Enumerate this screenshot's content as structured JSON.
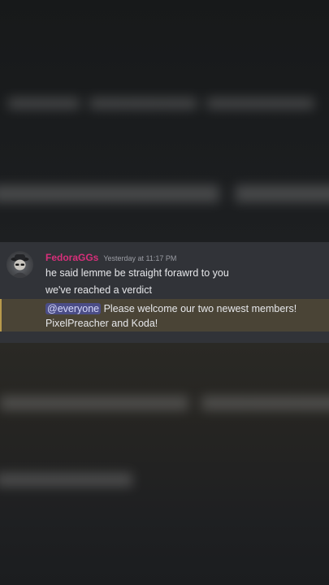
{
  "message": {
    "username": "FedoraGGs",
    "timestamp": "Yesterday at 11:17 PM",
    "lines": [
      "he said lemme be straight forawrd to you",
      "we've reached a verdict"
    ],
    "mention": "@everyone",
    "mention_text": " Please welcome our two newest members!",
    "mention_text_line2": "PixelPreacher and Koda!"
  },
  "colors": {
    "panel_bg": "#313338",
    "username": "#d72f7a",
    "mention_highlight": "#4a4436",
    "mention_pill": "#4b4d86"
  },
  "icons": {
    "avatar": "fedora-character-avatar"
  }
}
